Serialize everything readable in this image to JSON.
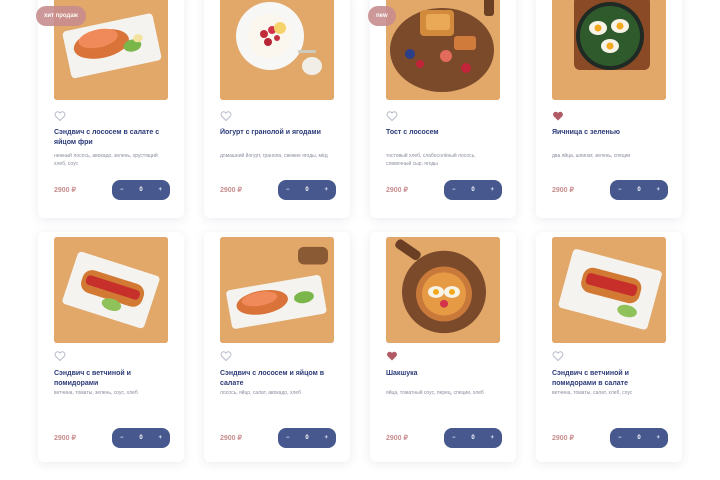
{
  "colors": {
    "accent": "#46588e",
    "title": "#2b3a78",
    "price": "#c88d8f",
    "badge": "#c88d8f",
    "photo_bg": "#e2a86a"
  },
  "icons": {
    "favorite": "heart-icon",
    "minus": "minus-icon",
    "plus": "plus-icon"
  },
  "stepper": {
    "minus": "−",
    "plus": "+"
  },
  "cards": [
    {
      "badge": "хит продаж",
      "favorite": false,
      "title": "Сэндвич с лососем в салате с яйцом фри",
      "description": "нежный лосось, авокадо, зелень, хрустящий хлеб, соус",
      "price": "2900 ₽",
      "qty": "0",
      "photo": "sandwich-salmon"
    },
    {
      "badge": "",
      "favorite": false,
      "title": "Йогурт с гранолой и ягодами",
      "description": "домашний йогурт, гранола, свежие ягоды, мёд",
      "price": "2900 ₽",
      "qty": "0",
      "photo": "yogurt-bowl"
    },
    {
      "badge": "new",
      "favorite": false,
      "title": "Тост с лососем",
      "description": "тостовый хлеб, слабосолёный лосось, сливочный сыр, ягоды",
      "price": "2900 ₽",
      "qty": "0",
      "photo": "board-toast"
    },
    {
      "badge": "",
      "favorite": true,
      "title": "Яичница с зеленью",
      "description": "два яйца, шпинат, зелень, специи",
      "price": "2900 ₽",
      "qty": "0",
      "photo": "eggs-pan"
    },
    {
      "badge": "",
      "favorite": false,
      "title": "Сэндвич с ветчиной и помидорами",
      "description": "ветчина, томаты, зелень, соус, хлеб",
      "price": "2900 ₽",
      "qty": "0",
      "photo": "sandwich-tomato"
    },
    {
      "badge": "",
      "favorite": false,
      "title": "Сэндвич с лососем и яйцом в салате",
      "description": "лосось, яйцо, салат, авокадо, хлеб",
      "price": "2900 ₽",
      "qty": "0",
      "photo": "sandwich-salmon-2"
    },
    {
      "badge": "",
      "favorite": true,
      "title": "Шакшука",
      "description": "яйца, томатный соус, перец, специи, хлеб",
      "price": "2900 ₽",
      "qty": "0",
      "photo": "shakshuka-board"
    },
    {
      "badge": "",
      "favorite": false,
      "title": "Сэндвич с ветчиной и помидорами в салате",
      "description": "ветчина, томаты, салат, хлеб, соус",
      "price": "2900 ₽",
      "qty": "0",
      "photo": "sandwich-tomato-2"
    }
  ]
}
